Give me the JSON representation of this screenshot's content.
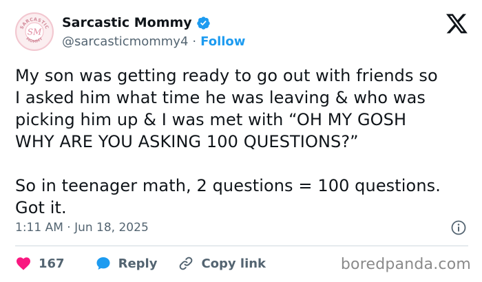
{
  "author": {
    "display_name": "Sarcastic Mommy",
    "handle": "@sarcasticmommy4",
    "separator": "·",
    "follow_label": "Follow",
    "avatar": {
      "top_text": "SARCASTIC",
      "initials": "SM",
      "bottom_text": "MOMMY"
    }
  },
  "tweet": {
    "paragraph1_lines": [
      "My son was getting ready to go out with friends so",
      "I asked him what time he was leaving & who was",
      "picking him up & I was met with “OH MY GOSH",
      "WHY ARE YOU ASKING 100 QUESTIONS?”"
    ],
    "paragraph2_lines": [
      "So in teenager math, 2 questions = 100 questions.",
      "Got it."
    ],
    "timestamp": "1:11 AM · Jun 18, 2025"
  },
  "actions": {
    "like_count": "167",
    "reply_label": "Reply",
    "copy_link_label": "Copy link"
  },
  "watermark": "boredpanda.com",
  "colors": {
    "accent_blue": "#1d9bf0",
    "like_red": "#f91880",
    "text_primary": "#0f1419",
    "text_secondary": "#536471"
  },
  "icons": [
    "verified-badge-icon",
    "x-logo-icon",
    "info-icon",
    "heart-icon",
    "reply-bubble-icon",
    "link-icon"
  ]
}
